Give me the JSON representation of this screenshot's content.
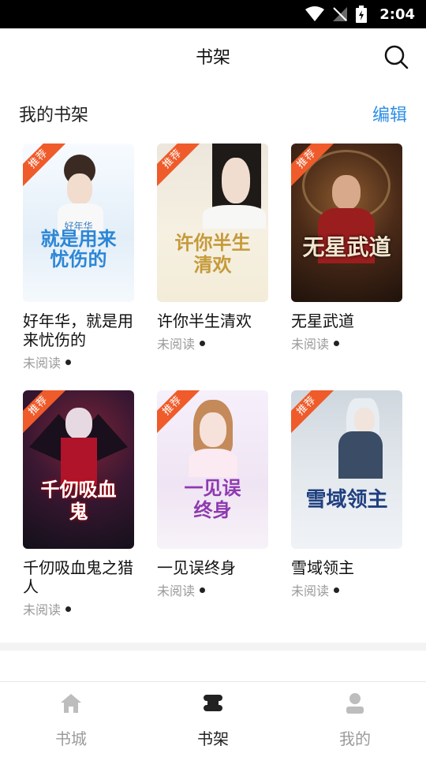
{
  "status_bar": {
    "time": "2:04"
  },
  "header": {
    "title": "书架"
  },
  "shelf": {
    "heading": "我的书架",
    "edit_label": "编辑"
  },
  "books": [
    {
      "title": "好年华，就是用来忧伤的",
      "status": "未阅读",
      "badge": "推荐",
      "cover_text": "就是用来忧伤的",
      "cover_top": "好年华",
      "cover_color": "#eaf3fb"
    },
    {
      "title": "许你半生清欢",
      "status": "未阅读",
      "badge": "推荐",
      "cover_text": "许你半生清欢",
      "cover_color": "#f4efe2"
    },
    {
      "title": "无星武道",
      "status": "未阅读",
      "badge": "推荐",
      "cover_text": "无星武道",
      "cover_color": "#3a2418"
    },
    {
      "title": "千仞吸血鬼之猎人",
      "status": "未阅读",
      "badge": "推荐",
      "cover_text": "千仞吸血鬼",
      "cover_color": "#2a1630"
    },
    {
      "title": "一见误终身",
      "status": "未阅读",
      "badge": "推荐",
      "cover_text": "一见误终身",
      "cover_color": "#f1e9f3"
    },
    {
      "title": "雪域领主",
      "status": "未阅读",
      "badge": "推荐",
      "cover_text": "雪域领主",
      "cover_color": "#dfe6ee"
    }
  ],
  "tabs": [
    {
      "label": "书城",
      "icon": "home-icon",
      "active": false
    },
    {
      "label": "书架",
      "icon": "bookshelf-icon",
      "active": true
    },
    {
      "label": "我的",
      "icon": "user-icon",
      "active": false
    }
  ]
}
